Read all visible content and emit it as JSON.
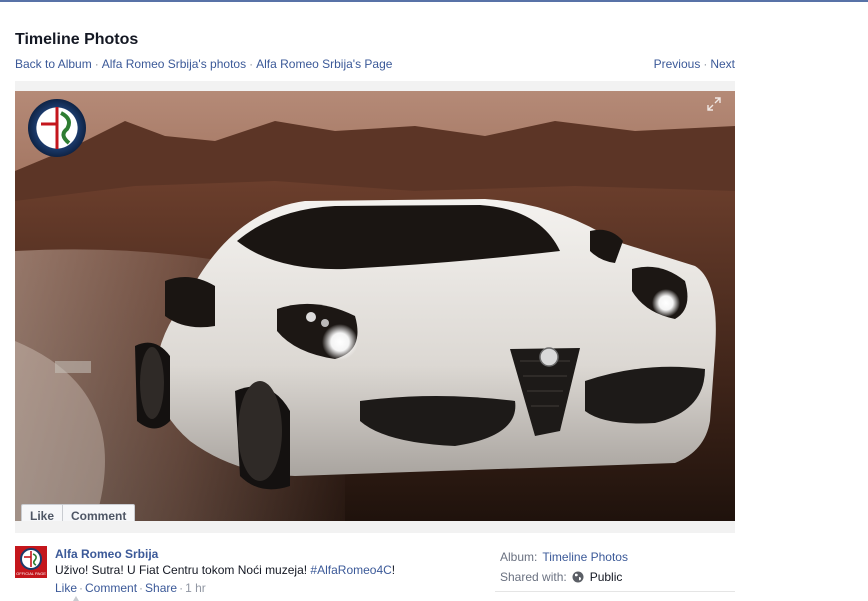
{
  "header": {
    "title": "Timeline Photos"
  },
  "breadcrumbs": {
    "back_to_album": "Back to Album",
    "owner_photos": "Alfa Romeo Srbija's photos",
    "owner_page": "Alfa Romeo Srbija's Page",
    "separator": "·"
  },
  "pager": {
    "previous": "Previous",
    "next": "Next",
    "separator": "·"
  },
  "photo": {
    "logo_text": "ALFA ROMEO",
    "expand_icon": "expand-icon",
    "colors": {
      "sky": "#8a5a45",
      "car_body": "#e9e6e2",
      "logo_ring": "#1b3a6b"
    }
  },
  "photo_actions": {
    "like": "Like",
    "comment": "Comment"
  },
  "post": {
    "avatar_icon": "alfa-romeo-avatar-icon",
    "avatar_caption": "OFFICIAL PAGE",
    "author": "Alfa Romeo Srbija",
    "caption_text": "Uživo! Sutra! U Fiat Centru tokom Noći muzeja! ",
    "caption_hashtag": "#AlfaRomeo4C",
    "caption_end": "!",
    "actions": {
      "like": "Like",
      "comment": "Comment",
      "share": "Share",
      "time": "1 hr",
      "separator": "·"
    }
  },
  "meta": {
    "album_label": "Album:",
    "album_value": "Timeline Photos",
    "shared_label": "Shared with:",
    "shared_value": "Public",
    "shared_icon": "globe-icon"
  },
  "colors": {
    "link": "#3b5998",
    "muted": "#9197a3",
    "text": "#141823"
  }
}
